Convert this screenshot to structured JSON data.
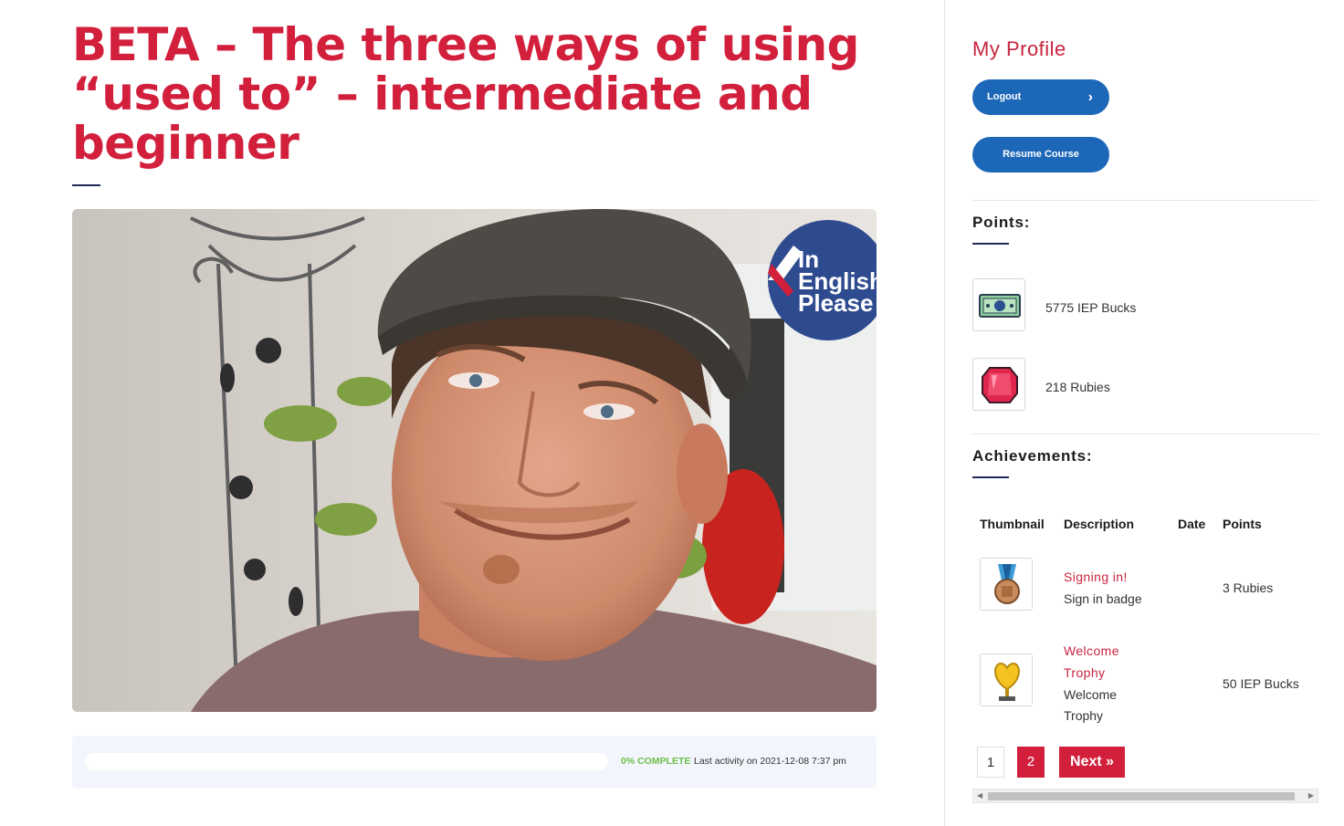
{
  "lesson": {
    "title": "BETA – The three ways of using “used to” – intermediate and beginner",
    "hero_image": {
      "badge_line1": "In",
      "badge_line2": "English",
      "badge_line3": "Please"
    },
    "progress": {
      "percent": 0,
      "complete_label": "0% COMPLETE",
      "last_activity": "Last activity on 2021-12-08 7:37 pm"
    }
  },
  "sidebar": {
    "profile_title": "My Profile",
    "logout_label": "Logout",
    "resume_label": "Resume Course",
    "points": {
      "title": "Points:",
      "items": [
        {
          "icon": "money-bill-icon",
          "label": "5775 IEP Bucks"
        },
        {
          "icon": "ruby-icon",
          "label": "218 Rubies"
        }
      ]
    },
    "achievements": {
      "title": "Achievements:",
      "headers": {
        "thumbnail": "Thumbnail",
        "description": "Description",
        "date": "Date",
        "points": "Points"
      },
      "rows": [
        {
          "icon": "medal-icon",
          "name": "Signing in!",
          "description": "Sign in badge",
          "date": "",
          "points": "3 Rubies"
        },
        {
          "icon": "trophy-icon",
          "name_line1": "Welcome",
          "name_line2": "Trophy",
          "description_line1": "Welcome",
          "description_line2": "Trophy",
          "date": "",
          "points": "50 IEP Bucks"
        }
      ]
    },
    "pagination": {
      "page1": "1",
      "page2": "2",
      "next": "Next »"
    }
  },
  "colors": {
    "accent": "#d21f3c",
    "button": "#1d67b8",
    "progress_text": "#6cc04a"
  }
}
